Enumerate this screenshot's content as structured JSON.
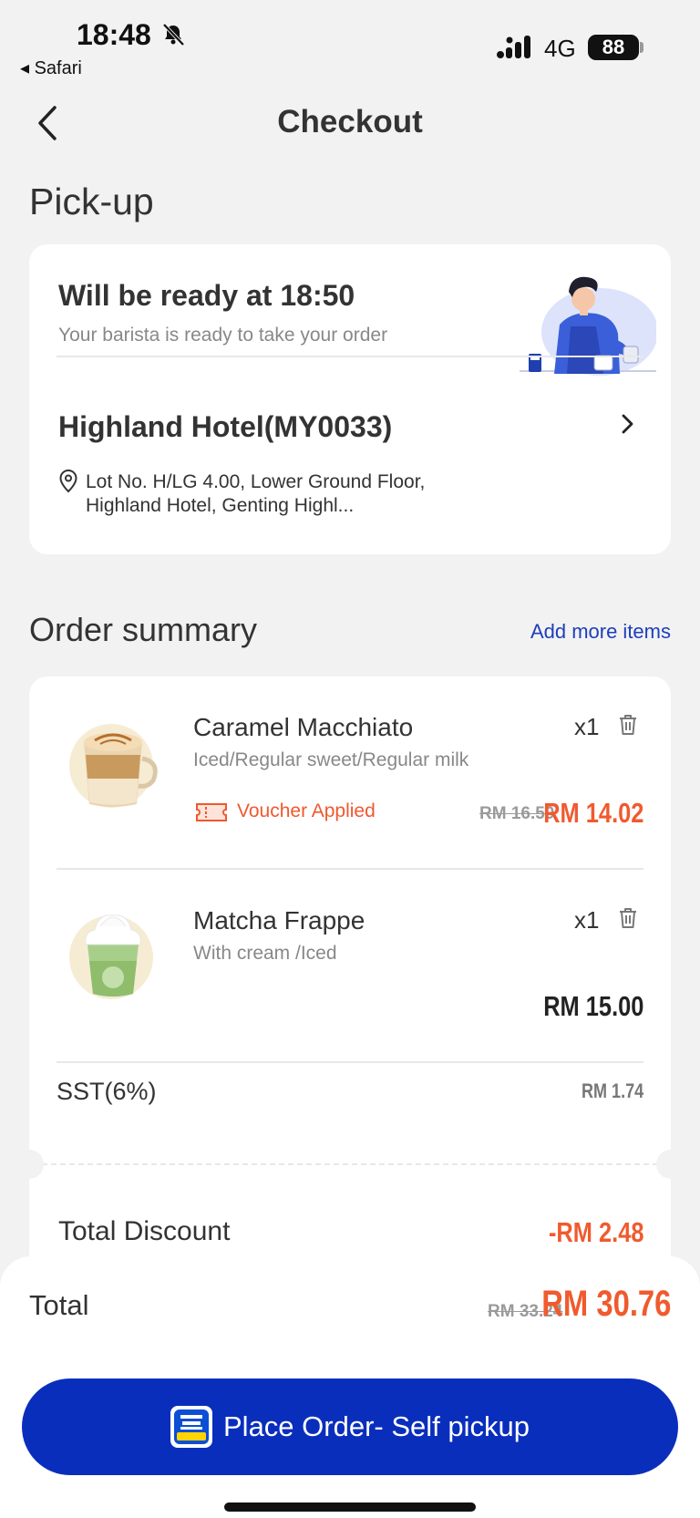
{
  "status_bar": {
    "time": "18:48",
    "back_app": "◂ Safari",
    "network": "4G",
    "battery": "88"
  },
  "header": {
    "title": "Checkout",
    "back_icon": "chevron-left-icon"
  },
  "pickup": {
    "section_title": "Pick-up",
    "ready_title": "Will be ready at 18:50",
    "ready_subtitle": "Your barista is ready to take your order",
    "store_name": "Highland Hotel(MY0033)",
    "store_address": "Lot No. H/LG 4.00, Lower Ground Floor, Highland Hotel, Genting Highl..."
  },
  "summary": {
    "section_title": "Order summary",
    "add_more": "Add more items",
    "items": [
      {
        "name": "Caramel Macchiato",
        "options": "Iced/Regular sweet/Regular milk",
        "qty": "x1",
        "voucher": "Voucher Applied",
        "old_price": "RM 16.50",
        "price": "RM 14.02"
      },
      {
        "name": "Matcha Frappe",
        "options": "With cream /Iced",
        "qty": "x1",
        "price": "RM 15.00"
      }
    ],
    "sst_label": "SST(6%)",
    "sst_value": "RM 1.74",
    "discount_label": "Total Discount",
    "discount_value": "-RM 2.48"
  },
  "footer": {
    "total_label": "Total",
    "total_old": "RM 33.24",
    "total": "RM 30.76",
    "place_order": "Place Order- Self pickup"
  },
  "colors": {
    "accent_blue": "#0a2ebc",
    "link_blue": "#1d3fbb",
    "price_red": "#f05a2e",
    "background": "#f2f2f2"
  }
}
